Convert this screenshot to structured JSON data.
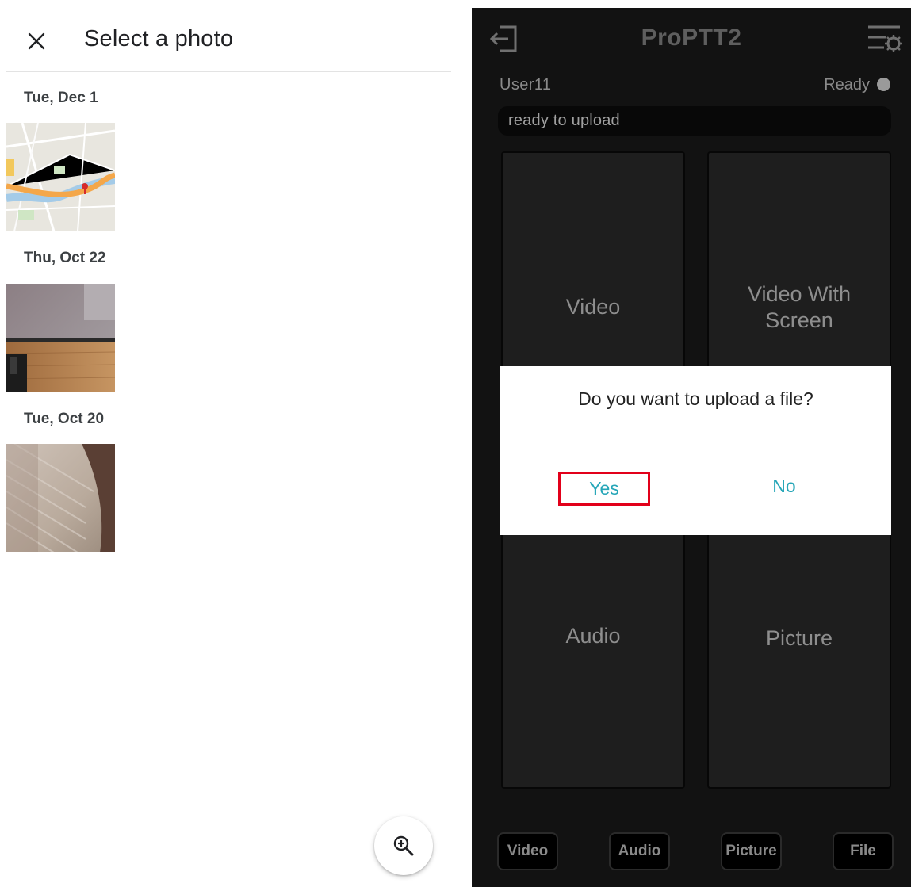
{
  "picker": {
    "title": "Select a photo",
    "groups": [
      {
        "date": "Tue, Dec 1",
        "photo": "map-photo"
      },
      {
        "date": "Thu, Oct 22",
        "photo": "desk-photo"
      },
      {
        "date": "Tue, Oct 20",
        "photo": "fabric-photo"
      }
    ],
    "zoom_icon": "zoom-in-icon"
  },
  "app": {
    "title": "ProPTT2",
    "user": "User11",
    "status": "Ready",
    "status_message": "ready to upload",
    "tiles": [
      {
        "label": "Video"
      },
      {
        "label": "Video With Screen"
      },
      {
        "label": "Audio"
      },
      {
        "label": "Picture"
      }
    ],
    "bottom_buttons": [
      {
        "label": "Video"
      },
      {
        "label": "Audio"
      },
      {
        "label": "Picture"
      },
      {
        "label": "File"
      }
    ],
    "colors": {
      "background": "#121212",
      "tile": "#1e1e1e",
      "accent": "#26a6b8",
      "highlight": "#e2001a"
    }
  },
  "dialog": {
    "message": "Do you want to upload a file?",
    "yes_label": "Yes",
    "no_label": "No"
  }
}
